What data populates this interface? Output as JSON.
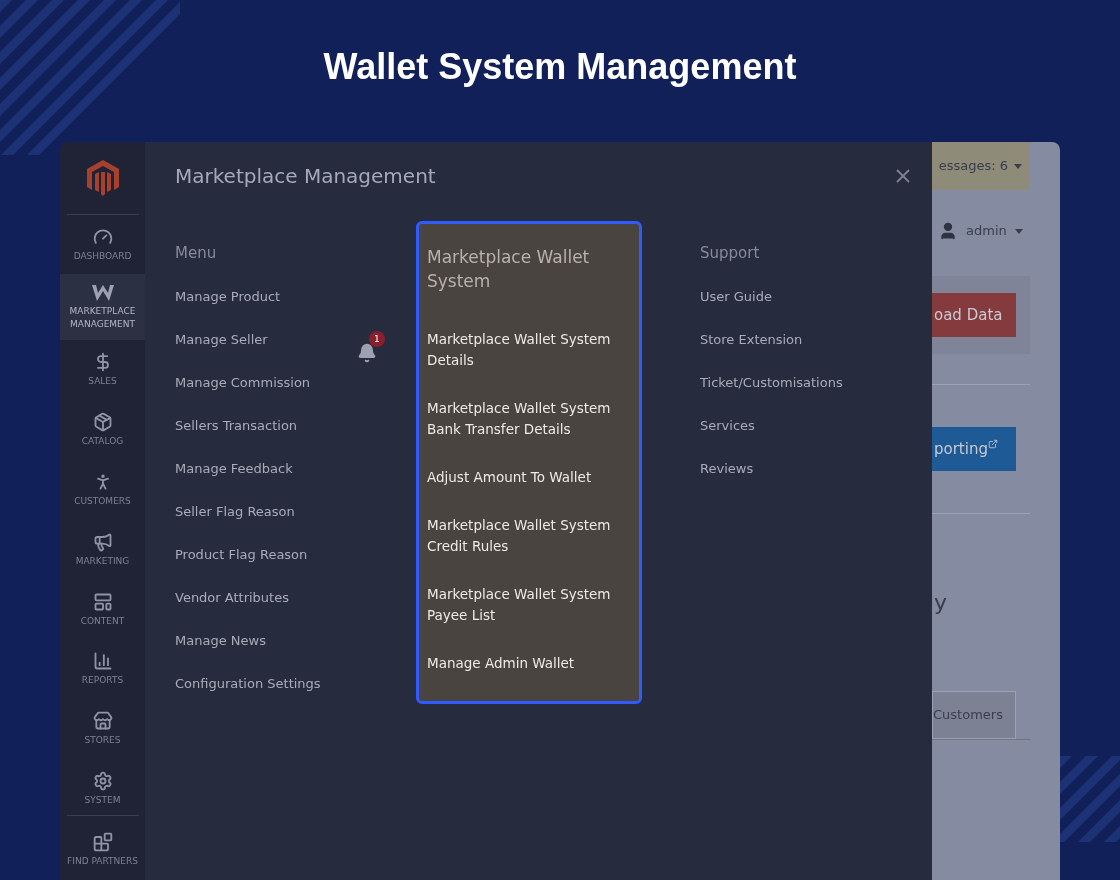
{
  "heading": "Wallet System Management",
  "sidebar": {
    "items": [
      {
        "label": "DASHBOARD",
        "kind": "gauge",
        "selected": false
      },
      {
        "label": "MARKETPLACE MANAGEMENT",
        "kind": "zigzag",
        "selected": true
      },
      {
        "label": "SALES",
        "kind": "dollar",
        "selected": false
      },
      {
        "label": "CATALOG",
        "kind": "box",
        "selected": false
      },
      {
        "label": "CUSTOMERS",
        "kind": "person",
        "selected": false
      },
      {
        "label": "MARKETING",
        "kind": "megaphone",
        "selected": false
      },
      {
        "label": "CONTENT",
        "kind": "layout",
        "selected": false
      },
      {
        "label": "REPORTS",
        "kind": "bars",
        "selected": false
      },
      {
        "label": "STORES",
        "kind": "store",
        "selected": false
      },
      {
        "label": "SYSTEM",
        "kind": "gear",
        "selected": false
      },
      {
        "label": "FIND PARTNERS",
        "kind": "blocks",
        "selected": false
      }
    ]
  },
  "menu_panel": {
    "title": "Marketplace Management",
    "notification_count": "1",
    "columns": [
      {
        "heading": "Menu",
        "highlighted": false,
        "items": [
          "Manage Product",
          "Manage Seller",
          "Manage Commission",
          "Sellers Transaction",
          "Manage Feedback",
          "Seller Flag Reason",
          "Product Flag Reason",
          "Vendor Attributes",
          "Manage News",
          "Configuration Settings"
        ]
      },
      {
        "heading": "Marketplace Wallet System",
        "highlighted": true,
        "items": [
          "Marketplace Wallet System Details",
          "Marketplace Wallet System Bank Transfer Details",
          "Adjust Amount To Wallet",
          "Marketplace Wallet System Credit Rules",
          "Marketplace Wallet System Payee List",
          "Manage Admin Wallet"
        ]
      },
      {
        "heading": "Support",
        "highlighted": false,
        "items": [
          "User Guide",
          "Store Extension",
          "Ticket/Customisations",
          "Services",
          "Reviews"
        ]
      }
    ]
  },
  "background_page": {
    "messages": "essages: 6",
    "user": "admin",
    "buttons": [
      {
        "label": "oad Data",
        "kind": "danger"
      },
      {
        "label": "porting",
        "kind": "primary"
      }
    ],
    "fragment": "y",
    "tab": "Customers"
  }
}
